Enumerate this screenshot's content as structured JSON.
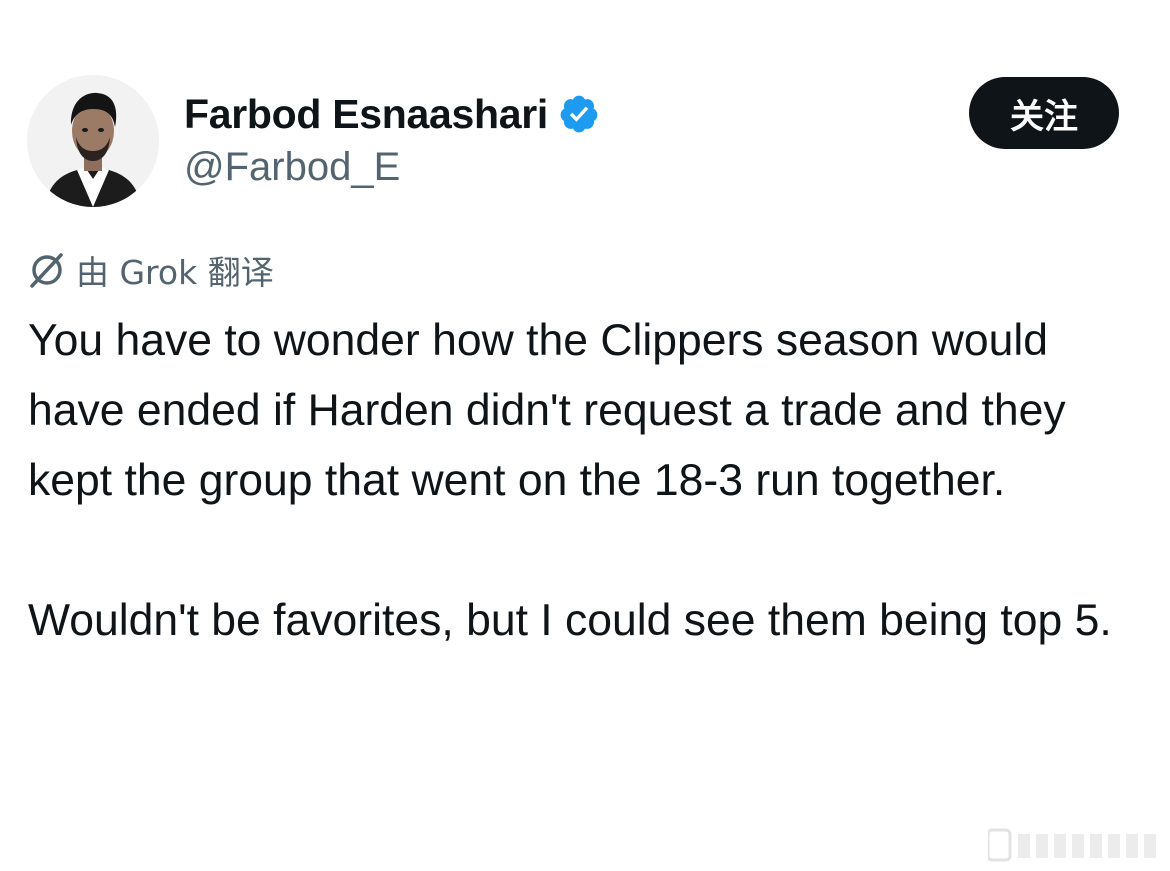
{
  "author": {
    "display_name": "Farbod Esnaashari",
    "handle": "@Farbod_E",
    "verified": true,
    "verified_color": "#1d9bf0",
    "avatar_icon": "profile-photo"
  },
  "follow_button": {
    "label": "关注"
  },
  "translation": {
    "icon": "grok-icon",
    "label": "由 Grok 翻译"
  },
  "tweet": {
    "paragraphs": [
      "You have to wonder how the Clippers season would have ended if Harden didn't request a trade and they kept the group that went on the 18-3 run together.",
      "Wouldn't be favorites, but I could see them being top 5."
    ]
  },
  "colors": {
    "text_primary": "#0f1419",
    "text_secondary": "#536471",
    "button_bg": "#0f1419",
    "button_text": "#ffffff"
  }
}
